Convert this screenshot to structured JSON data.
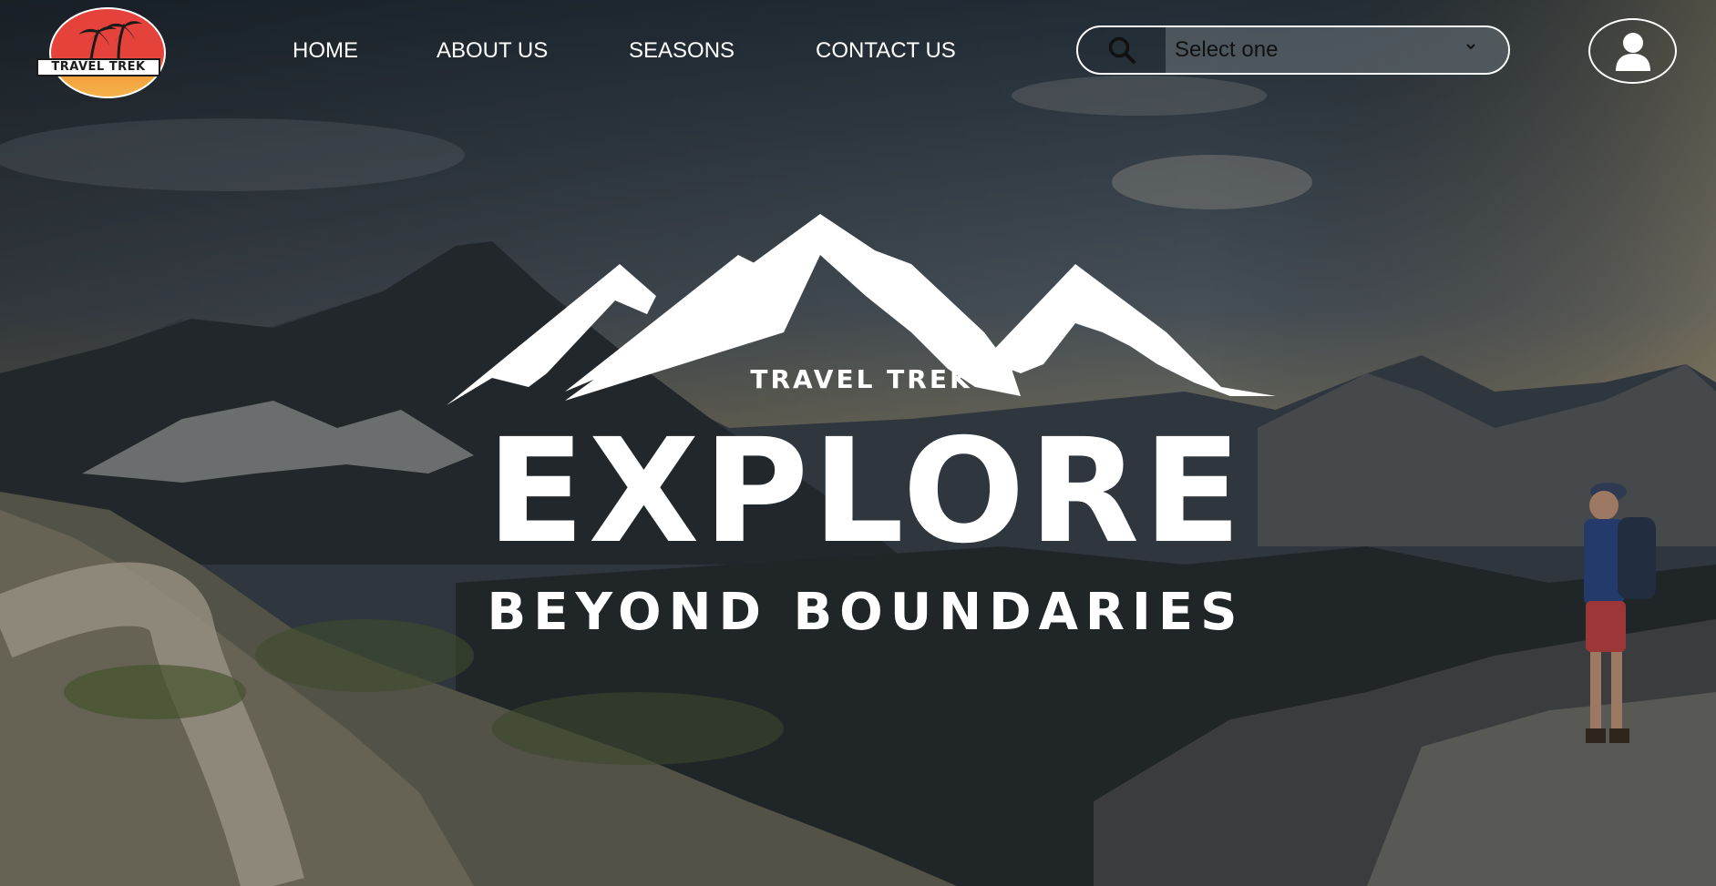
{
  "brand": {
    "logo_text": "TRAVEL TREK"
  },
  "nav": {
    "items": [
      {
        "label": "HOME"
      },
      {
        "label": "ABOUT US"
      },
      {
        "label": "SEASONS"
      },
      {
        "label": "CONTACT US"
      }
    ]
  },
  "search": {
    "icon": "search-icon",
    "selected": "Select one"
  },
  "user": {
    "icon": "user-icon"
  },
  "hero": {
    "brand": "TRAVEL TREK",
    "title": "EXPLORE",
    "subtitle": "BEYOND BOUNDARIES"
  },
  "colors": {
    "text": "#ffffff",
    "logo_red": "#e5423b",
    "logo_orange": "#f2a03d"
  }
}
